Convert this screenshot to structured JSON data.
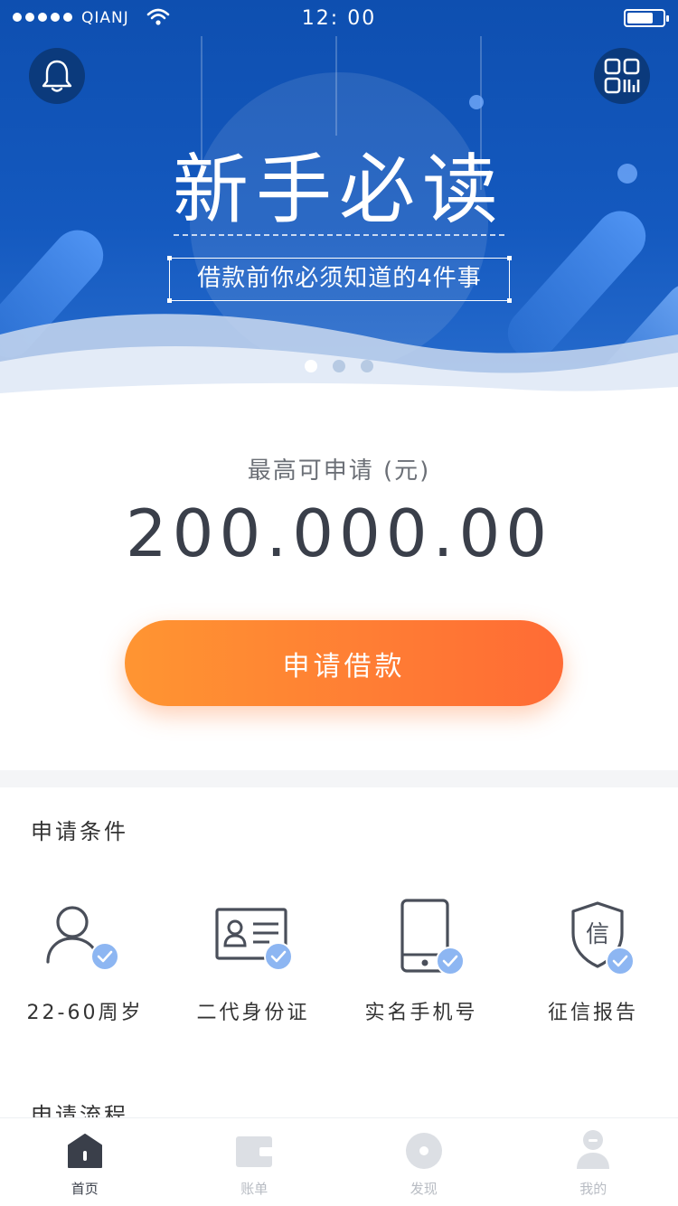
{
  "colors": {
    "banner": "#1459bf",
    "accent_orange": "#ff7a34",
    "text_dark": "#3a3f4a",
    "check_blue": "#8db6f2",
    "tab_inactive": "#b8bcc3"
  },
  "status_bar": {
    "carrier": "QIANJ",
    "time": "12: 00",
    "signal_dots": 5,
    "battery_level": 0.62
  },
  "banner": {
    "bell_icon": "bell-icon",
    "scan_icon": "qr-scan-icon",
    "title": "新手必读",
    "subtitle": "借款前你必须知道的4件事",
    "carousel_pages": 3,
    "carousel_active": 0
  },
  "loan": {
    "label": "最高可申请 (元)",
    "amount": "200.000.00",
    "apply_button": "申请借款"
  },
  "conditions": {
    "title": "申请条件",
    "items": [
      {
        "label": "22-60周岁",
        "icon": "user-icon"
      },
      {
        "label": "二代身份证",
        "icon": "id-card-icon"
      },
      {
        "label": "实名手机号",
        "icon": "phone-icon"
      },
      {
        "label": "征信报告",
        "icon": "credit-shield-icon"
      }
    ]
  },
  "process": {
    "title": "申请流程"
  },
  "tabbar": {
    "items": [
      {
        "label": "首页",
        "icon": "home-icon",
        "active": true
      },
      {
        "label": "账单",
        "icon": "wallet-icon",
        "active": false
      },
      {
        "label": "发现",
        "icon": "discover-icon",
        "active": false
      },
      {
        "label": "我的",
        "icon": "profile-icon",
        "active": false
      }
    ]
  }
}
